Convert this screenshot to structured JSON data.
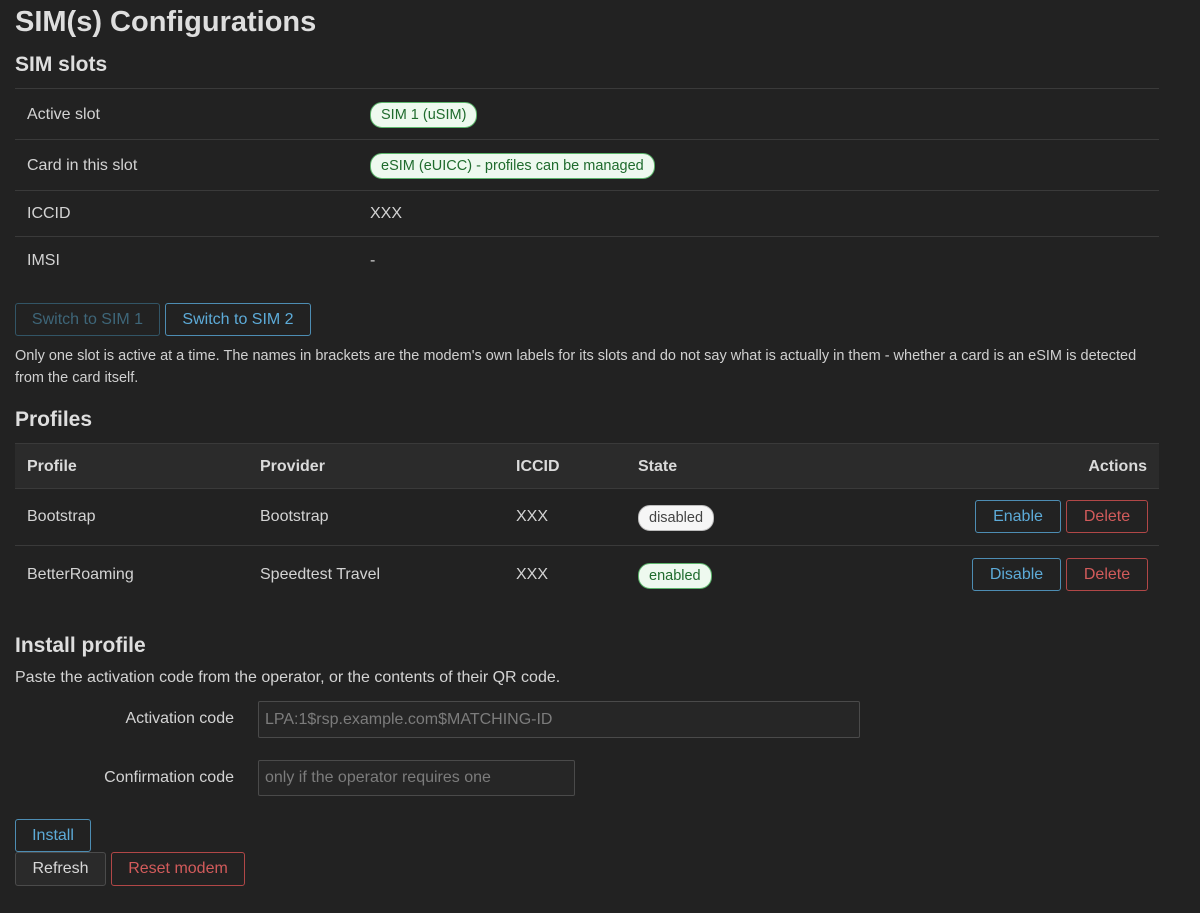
{
  "page": {
    "title": "SIM(s) Configurations"
  },
  "slots": {
    "heading": "SIM slots",
    "rows": [
      {
        "label": "Active slot",
        "value": "SIM 1 (uSIM)"
      },
      {
        "label": "Card in this slot",
        "value": "eSIM (eUICC) - profiles can be managed"
      },
      {
        "label": "ICCID",
        "value": "XXX"
      },
      {
        "label": "IMSI",
        "value": "-"
      }
    ],
    "switch_sim1_label": "Switch to SIM 1",
    "switch_sim2_label": "Switch to SIM 2",
    "note": "Only one slot is active at a time. The names in brackets are the modem's own labels for its slots and do not say what is actually in them - whether a card is an eSIM is detected from the card itself."
  },
  "profiles": {
    "heading": "Profiles",
    "columns": {
      "profile": "Profile",
      "provider": "Provider",
      "iccid": "ICCID",
      "state": "State",
      "actions": "Actions"
    },
    "rows": [
      {
        "profile": "Bootstrap",
        "provider": "Bootstrap",
        "iccid": "XXX",
        "state": "disabled",
        "toggle_label": "Enable",
        "delete_label": "Delete"
      },
      {
        "profile": "BetterRoaming",
        "provider": "Speedtest Travel",
        "iccid": "XXX",
        "state": "enabled",
        "toggle_label": "Disable",
        "delete_label": "Delete"
      }
    ]
  },
  "install": {
    "heading": "Install profile",
    "intro": "Paste the activation code from the operator, or the contents of their QR code.",
    "activation_label": "Activation code",
    "activation_value": "",
    "activation_placeholder": "LPA:1$rsp.example.com$MATCHING-ID",
    "confirmation_label": "Confirmation code",
    "confirmation_value": "",
    "confirmation_placeholder": "only if the operator requires one",
    "install_label": "Install"
  },
  "footer": {
    "refresh_label": "Refresh",
    "reset_label": "Reset modem"
  },
  "colors": {
    "background": "#222222",
    "accent_blue": "#5dabd8",
    "danger_red": "#d25b5b",
    "badge_green": "#1f6b2d"
  }
}
